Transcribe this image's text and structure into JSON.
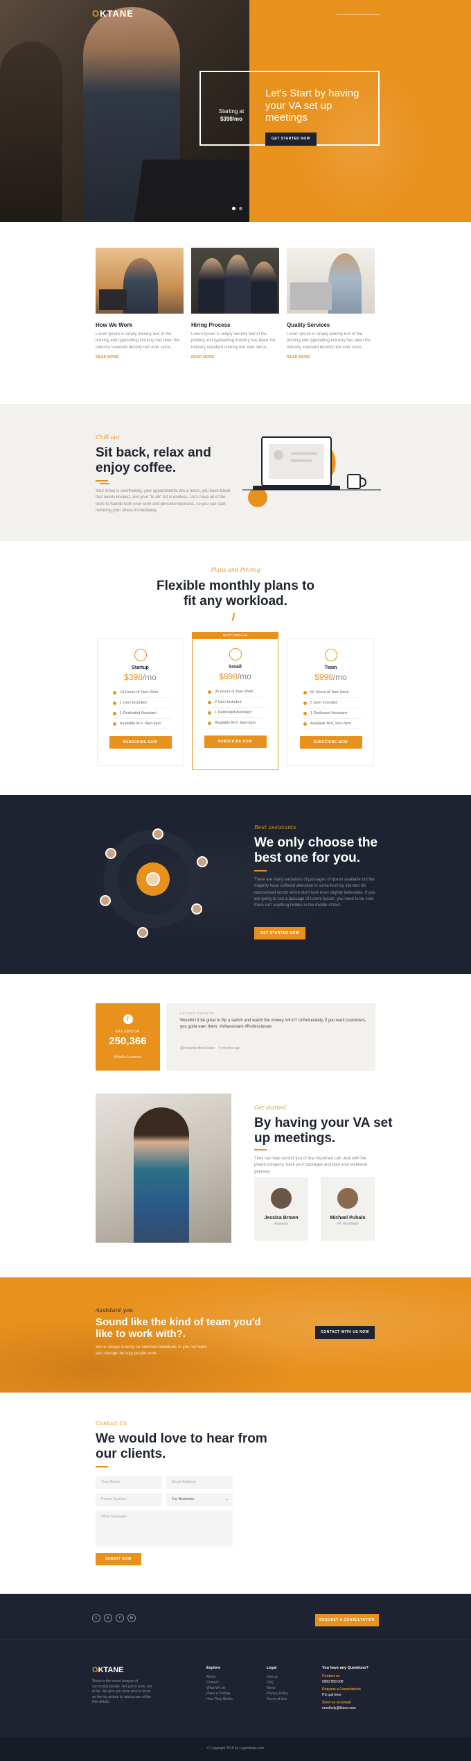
{
  "brand": {
    "logo_o": "O",
    "logo_rest": "KTANE",
    "accent": "#e8911d",
    "dark": "#1d2330"
  },
  "hero": {
    "nav_label": "",
    "starting_label": "Starting at",
    "starting_price": "$398/mo",
    "headline": "Let's Start by having your VA set up meetings",
    "cta": "GET STARTED NOW"
  },
  "services": [
    {
      "title": "How We Work",
      "text": "Lorem Ipsum is simply dummy text of the printing and typesetting industry has been the industry standard dummy text ever since...",
      "more": "READ MORE"
    },
    {
      "title": "Hiring Process",
      "text": "Lorem Ipsum is simply dummy text of the printing and typesetting industry has been the industry standard dummy text ever since...",
      "more": "READ MORE"
    },
    {
      "title": "Quality Services",
      "text": "Lorem Ipsum is simply dummy text of the printing and typesetting industry has been the industry standard dummy text ever since...",
      "more": "READ MORE"
    }
  ],
  "relax": {
    "script": "Chill out",
    "title": "Sit back, relax and enjoy coffee.",
    "text": "Your inbox is overflowing, your appointments are a mess, you have travel that needs booked, and your \"to do\" list is endless. Let's have all of the skills to handle both your work and personal business, so you can start reducing your stress immediately."
  },
  "pricing": {
    "script": "Plans and Pricing",
    "title": "Flexible monthly plans to fit any workload.",
    "plans": [
      {
        "badge": "",
        "name": "Startup",
        "price": "$398",
        "per": "/mo",
        "features": [
          "10 Hours of Task Work",
          "1 User Included",
          "1 Dedicated Assistant",
          "Available M-F, 9am-5pm"
        ],
        "cta": "SUBSCRIBE NOW"
      },
      {
        "badge": "MOST POPULAR",
        "name": "Small",
        "price": "$898",
        "per": "/mo",
        "features": [
          "35 Hours of Task Work",
          "2 User Included",
          "1 Dedicated Assistant",
          "Available M-F, 9am-5pm"
        ],
        "cta": "SUBSCRIBE NOW"
      },
      {
        "badge": "",
        "name": "Team",
        "price": "$998",
        "per": "/mo",
        "features": [
          "50 Hours of Task Work",
          "5 User Included",
          "1 Dedicated Assistant",
          "Available M-F, 9am-5pm"
        ],
        "cta": "SUBSCRIBE NOW"
      }
    ]
  },
  "best": {
    "script": "Best assistants",
    "title": "We only choose the best one for you.",
    "text": "There are many variations of passages of Ipsum available but the majority have suffered alteration in some form by injected his randomised words which don't look even slightly believable. If you are going to use a passage of Lorem Ipsum, you need to be sure there isn't anything hidden in the middle of text.",
    "cta": "GET STARTED NOW"
  },
  "social": {
    "fb_icon": "f",
    "fb_label": "FACEBOOK",
    "fb_count": "250,366",
    "fb_tag": "#WeAreFacebook",
    "tweets_label": "LATEST TWEETS",
    "tweet": "Wouldn't it be great to flip a switch and watch the money roll in? Unfortunately, if you want customers, you gotta earn them. #VAassistant #Professionals",
    "handle": "@InstantlyoffersTollow",
    "time": "5 minutes ago"
  },
  "setup": {
    "script": "Get started",
    "title": "By having your VA set up meetings.",
    "text": "They can help remind you of that important call, deal with the phone company, track your packages and plan your weekend getaway.",
    "people": [
      {
        "name": "Jessica Brown",
        "role": "Assistant"
      },
      {
        "name": "Michael Puhalo",
        "role": "VP, Worldwide"
      }
    ]
  },
  "team": {
    "script": "Assistant you",
    "title": "Sound like the kind of team you'd like to work with?.",
    "text": "We're always looking for talented individuals to join our team and change the way people work.",
    "cta": "CONTACT WITH US NOW"
  },
  "contact": {
    "script": "Contact Us",
    "title": "We would love to hear from our clients.",
    "placeholders": {
      "name": "Your Name",
      "email": "Email Address",
      "phone": "Phone Number",
      "message": "Write Message"
    },
    "select_value": "For Business",
    "send": "SUBMIT NOW"
  },
  "footer": {
    "social": [
      "t",
      "v",
      "f",
      "in"
    ],
    "cta": "REQUEST A CONSULTATION",
    "about": "Vision is the secret weapon of successful people. Not just in work, but in life. We give you more time to focus on the big picture by taking care of the little details.",
    "explore_title": "Explore",
    "explore": [
      "About",
      "Contact",
      "What We do",
      "Plans & Pricing",
      "How They Works"
    ],
    "legal_title": "Legal",
    "legal": [
      "Join us",
      "FAQ",
      "News",
      "Privacy Policy",
      "Terms of Use"
    ],
    "q_title": "You have any Questions?",
    "q_contact": "Contact us",
    "q_phone": "0900 858 008",
    "q_consult": "Request a Consultation",
    "q_consult_sub": "PS quit here",
    "q_send": "Send us an Email",
    "q_email": "needhelp@ktane.com",
    "copyright": "© Copyright 2018 by Layerdrops.com"
  }
}
